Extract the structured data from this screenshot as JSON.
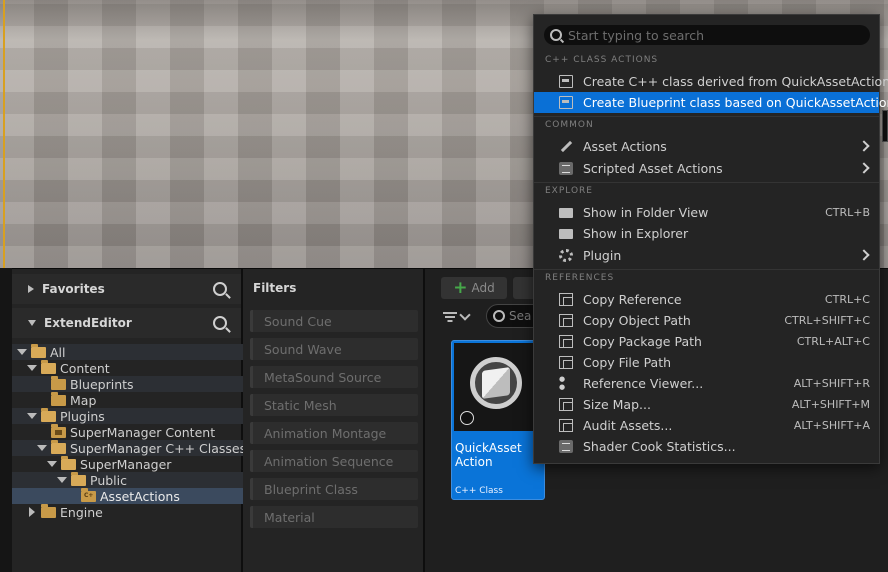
{
  "content_browser": {
    "favorites_label": "Favorites",
    "project_label": "ExtendEditor",
    "tree": [
      {
        "label": "All"
      },
      {
        "label": "Content"
      },
      {
        "label": "Blueprints"
      },
      {
        "label": "Map"
      },
      {
        "label": "Plugins"
      },
      {
        "label": "SuperManager Content"
      },
      {
        "label": "SuperManager C++ Classes"
      },
      {
        "label": "SuperManager"
      },
      {
        "label": "Public"
      },
      {
        "label": "AssetActions"
      },
      {
        "label": "Engine"
      }
    ],
    "filters_title": "Filters",
    "filters": [
      "Sound Cue",
      "Sound Wave",
      "MetaSound Source",
      "Static Mesh",
      "Animation Montage",
      "Animation Sequence",
      "Blueprint Class",
      "Material"
    ],
    "add_label": "Add",
    "search_placeholder": "Sea",
    "asset": {
      "name": "QuickAsset Action",
      "type": "C++ Class"
    }
  },
  "context_menu": {
    "search_placeholder": "Start typing to search",
    "sections": {
      "cpp": "C++ CLASS ACTIONS",
      "common": "COMMON",
      "explore": "EXPLORE",
      "references": "REFERENCES"
    },
    "items": [
      {
        "label": "Create C++ class derived from QuickAssetAction",
        "shortcut": ""
      },
      {
        "label": "Create Blueprint class based on QuickAssetAction",
        "shortcut": ""
      },
      {
        "label": "Asset Actions",
        "shortcut": ""
      },
      {
        "label": "Scripted Asset Actions",
        "shortcut": ""
      },
      {
        "label": "Show in Folder View",
        "shortcut": "CTRL+B"
      },
      {
        "label": "Show in Explorer",
        "shortcut": ""
      },
      {
        "label": "Plugin",
        "shortcut": ""
      },
      {
        "label": "Copy Reference",
        "shortcut": "CTRL+C"
      },
      {
        "label": "Copy Object Path",
        "shortcut": "CTRL+SHIFT+C"
      },
      {
        "label": "Copy Package Path",
        "shortcut": "CTRL+ALT+C"
      },
      {
        "label": "Copy File Path",
        "shortcut": ""
      },
      {
        "label": "Reference Viewer...",
        "shortcut": "ALT+SHIFT+R"
      },
      {
        "label": "Size Map...",
        "shortcut": "ALT+SHIFT+M"
      },
      {
        "label": "Audit Assets...",
        "shortcut": "ALT+SHIFT+A"
      },
      {
        "label": "Shader Cook Statistics...",
        "shortcut": ""
      }
    ]
  },
  "colors": {
    "highlight": "#0a70d6",
    "asset_tile": "#0a74d8",
    "folder": "#c89a48"
  }
}
